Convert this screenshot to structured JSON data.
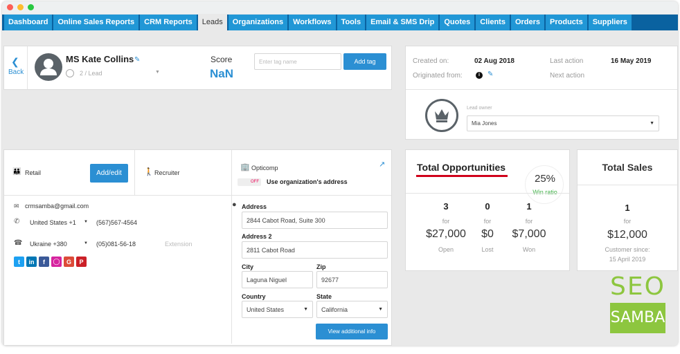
{
  "tabs": [
    {
      "label": "Dashboard"
    },
    {
      "label": "Online Sales Reports"
    },
    {
      "label": "CRM Reports"
    },
    {
      "label": "Leads",
      "active": true
    },
    {
      "label": "Organizations"
    },
    {
      "label": "Workflows"
    },
    {
      "label": "Tools"
    },
    {
      "label": "Email & SMS Drip"
    },
    {
      "label": "Quotes"
    },
    {
      "label": "Clients"
    },
    {
      "label": "Orders"
    },
    {
      "label": "Products"
    },
    {
      "label": "Suppliers"
    }
  ],
  "header": {
    "back_label": "Back",
    "name": "MS Kate Collins",
    "stage": "2 / Lead",
    "score_label": "Score",
    "score_value": "NaN",
    "tag_placeholder": "Enter tag name",
    "add_tag_label": "Add tag"
  },
  "meta": {
    "created_label": "Created on:",
    "created_value": "02 Aug 2018",
    "originated_label": "Originated from:",
    "last_action_label": "Last action",
    "last_action_value": "16 May 2019",
    "next_action_label": "Next action",
    "owner_label": "Lead owner",
    "owner_value": "Mia Jones"
  },
  "contact": {
    "category": "Retail",
    "add_edit_label": "Add/edit",
    "recruiter_label": "Recruiter",
    "org_name": "Opticomp",
    "toggle_state": "OFF",
    "use_org_address": "Use organization's address",
    "email": "crmsamba@gmail.com",
    "phone1_country": "United States +1",
    "phone1_number": "(567)567-4564",
    "phone2_country": "Ukraine +380",
    "phone2_number": "(05)081-56-18",
    "extension_placeholder": "Extension"
  },
  "address": {
    "address_label": "Address",
    "address_value": "2844 Cabot Road, Suite 300",
    "address2_label": "Address 2",
    "address2_value": "2811 Cabot Road",
    "city_label": "City",
    "city_value": "Laguna Niguel",
    "zip_label": "Zip",
    "zip_value": "92677",
    "country_label": "Country",
    "country_value": "United States",
    "state_label": "State",
    "state_value": "California",
    "view_info_label": "View additional info"
  },
  "opportunities": {
    "title": "Total Opportunities",
    "ratio": "25%",
    "ratio_label": "Win ratio",
    "columns": [
      {
        "count": "3",
        "for": "for",
        "amount": "$27,000",
        "status": "Open"
      },
      {
        "count": "0",
        "for": "for",
        "amount": "$0",
        "status": "Lost"
      },
      {
        "count": "1",
        "for": "for",
        "amount": "$7,000",
        "status": "Won"
      }
    ]
  },
  "sales": {
    "title": "Total Sales",
    "count": "1",
    "for": "for",
    "amount": "$12,000",
    "since_label": "Customer since:",
    "since_date": "15 April 2019"
  },
  "watermark": {
    "line1": "SEO",
    "line2": "SAMBA"
  },
  "colors": {
    "accent": "#2b8fd3",
    "nav": "#0a62a0",
    "underline": "#d0021b",
    "win": "#3cb043",
    "brand_green": "#8dc63f"
  }
}
